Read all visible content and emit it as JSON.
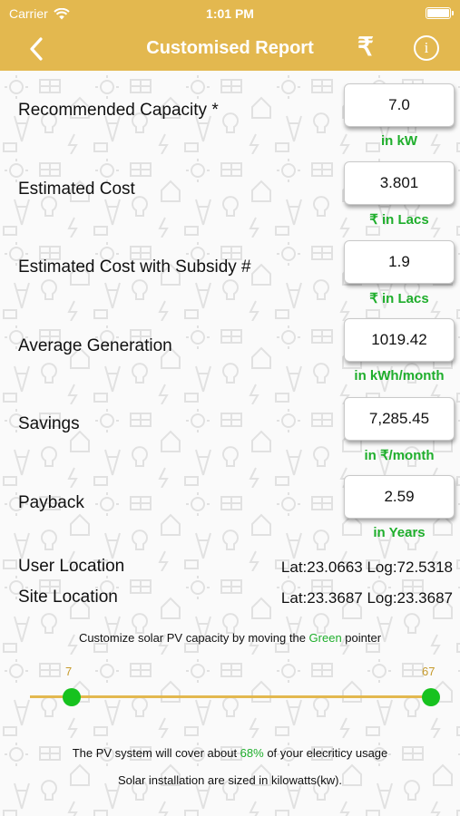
{
  "status_bar": {
    "carrier": "Carrier",
    "time": "1:01 PM"
  },
  "nav": {
    "title": "Customised Report",
    "currency_symbol": "₹",
    "info_symbol": "i"
  },
  "colors": {
    "header": "#e3b84f",
    "accent_green": "#1fae2c",
    "slider_knob": "#17c21f"
  },
  "rows": [
    {
      "label": "Recommended Capacity *",
      "value": "7.0",
      "unit": "in kW"
    },
    {
      "label": "Estimated Cost",
      "value": "3.801",
      "unit": "₹ in Lacs"
    },
    {
      "label": "Estimated Cost with Subsidy #",
      "value": "1.9",
      "unit": "₹ in Lacs"
    },
    {
      "label": "Average Generation",
      "value": "1019.42",
      "unit": "in kWh/month"
    },
    {
      "label": "Savings",
      "value": "7,285.45",
      "unit": "in ₹/month"
    },
    {
      "label": "Payback",
      "value": "2.59",
      "unit": "in Years"
    }
  ],
  "locations": {
    "user_label": "User Location",
    "user_value": "Lat:23.0663 Log:72.5318",
    "site_label": "Site Location",
    "site_value": "Lat:23.3687 Log:23.3687"
  },
  "slider": {
    "instruction_prefix": "Customize solar PV capacity by moving the ",
    "instruction_green": "Green",
    "instruction_suffix": " pointer",
    "min_label": "7",
    "max_label": "67"
  },
  "coverage": {
    "prefix": "The PV system will cover about ",
    "percent": "68%",
    "suffix": " of your elecriticy usage"
  },
  "sized_note": "Solar installation are sized in kilowatts(kw)."
}
